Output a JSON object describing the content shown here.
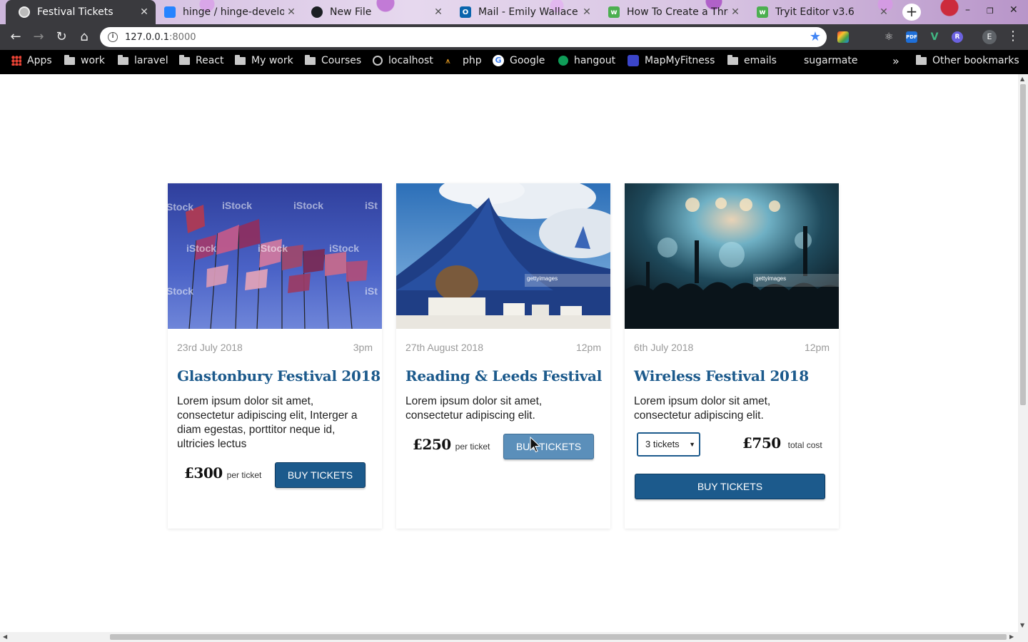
{
  "tabs": [
    {
      "title": "Festival Tickets",
      "active": true
    },
    {
      "title": "hinge / hinge-develo"
    },
    {
      "title": "New File"
    },
    {
      "title": "Mail - Emily Wallace -"
    },
    {
      "title": "How To Create a Thre"
    },
    {
      "title": "Tryit Editor v3.6"
    }
  ],
  "new_tab_label": "+",
  "window_controls": {
    "minimize": "–",
    "restore": "❐",
    "close": "✕"
  },
  "address_bar": {
    "host": "127.0.0.1",
    "port": ":8000"
  },
  "extensions": [
    "colorful-grid-icon",
    "react-icon",
    "pdf-icon",
    "vue-icon",
    "r-icon"
  ],
  "profile_initial": "E",
  "bookmarks": [
    {
      "label": "Apps",
      "icon": "apps-grid-icon"
    },
    {
      "label": "work",
      "icon": "folder-icon"
    },
    {
      "label": "laravel",
      "icon": "folder-icon"
    },
    {
      "label": "React",
      "icon": "folder-icon"
    },
    {
      "label": "My work",
      "icon": "folder-icon"
    },
    {
      "label": "Courses",
      "icon": "folder-icon"
    },
    {
      "label": "localhost",
      "icon": "globe-icon"
    },
    {
      "label": "php",
      "icon": "php-icon"
    },
    {
      "label": "Google",
      "icon": "google-icon"
    },
    {
      "label": "hangout",
      "icon": "hangout-icon"
    },
    {
      "label": "MapMyFitness",
      "icon": "mapmyfitness-icon"
    },
    {
      "label": "emails",
      "icon": "folder-icon"
    },
    {
      "label": "sugarmate",
      "icon": ""
    }
  ],
  "bookmarks_overflow": "»",
  "other_bookmarks": "Other bookmarks",
  "cards": [
    {
      "date": "23rd July 2018",
      "time": "3pm",
      "title": "Glastonbury Festival 2018",
      "description": "Lorem ipsum dolor sit amet, consectetur adipiscing elit, Interger a diam egestas, porttitor neque id, ultricies lectus",
      "price": "£300",
      "price_unit": "per ticket",
      "button": "BUY TICKETS"
    },
    {
      "date": "27th August 2018",
      "time": "12pm",
      "title": "Reading & Leeds Festival",
      "description": "Lorem ipsum dolor sit amet, consectetur adipiscing elit.",
      "price": "£250",
      "price_unit": "per ticket",
      "button": "BUY TICKETS"
    },
    {
      "date": "6th July 2018",
      "time": "12pm",
      "title": "Wireless Festival 2018",
      "description": "Lorem ipsum dolor sit amet, consectetur adipiscing elit.",
      "quantity": "3 tickets",
      "price": "£750",
      "price_unit": "total cost",
      "button": "BUY TICKETS"
    }
  ],
  "colors": {
    "accent": "#1c5a8c",
    "accent_hover": "#5b8fba"
  }
}
